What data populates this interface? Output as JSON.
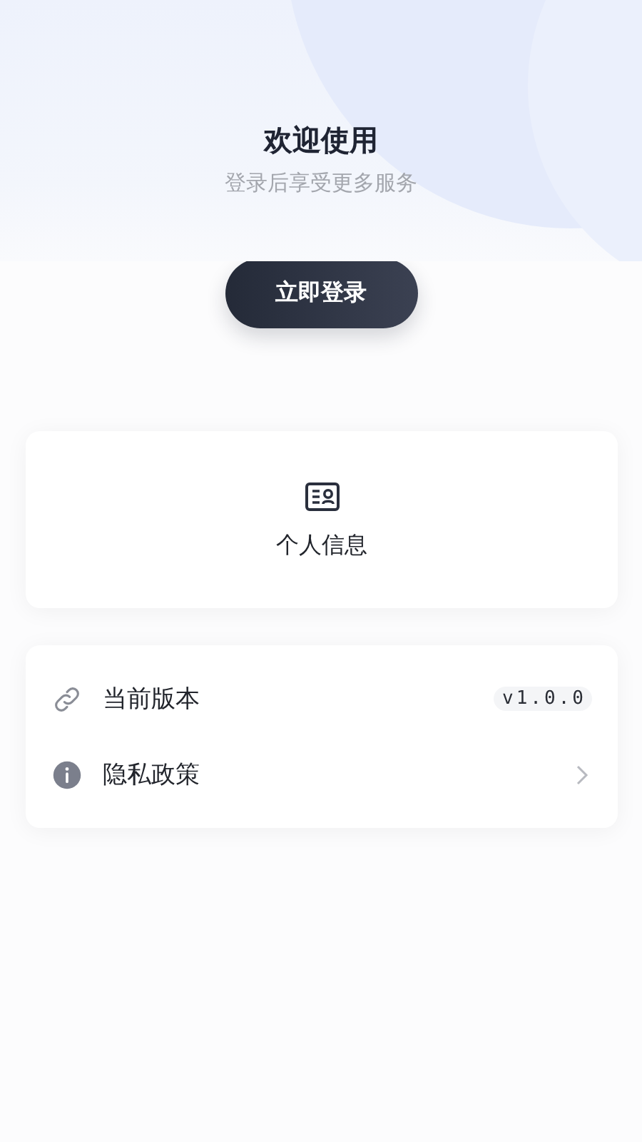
{
  "header": {
    "title": "欢迎使用",
    "subtitle": "登录后享受更多服务"
  },
  "login_button": {
    "label": "立即登录"
  },
  "profile_card": {
    "label": "个人信息"
  },
  "settings": [
    {
      "kind": "value",
      "label": "当前版本",
      "value": "v1.0.0"
    },
    {
      "kind": "link",
      "label": "隐私政策"
    }
  ]
}
